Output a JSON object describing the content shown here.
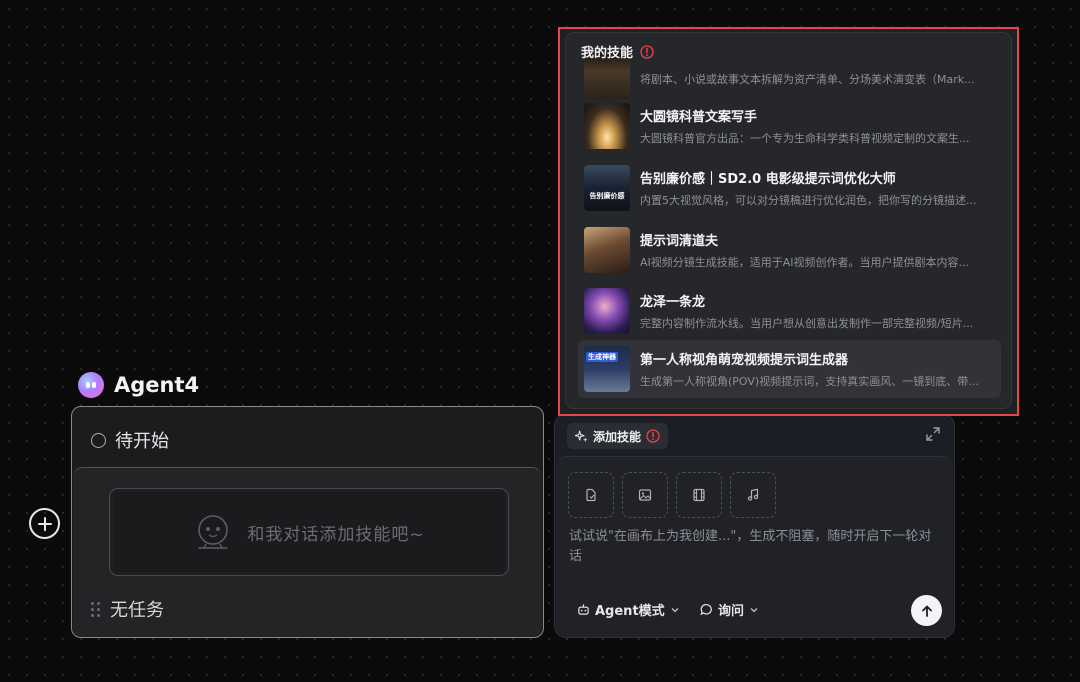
{
  "agent": {
    "name": "Agent4",
    "status": "待开始",
    "chat_hint": "和我对话添加技能吧~",
    "task_label": "无任务"
  },
  "input_panel": {
    "add_skill_label": "添加技能",
    "prompt_placeholder": "试试说\"在画布上为我创建...\"，生成不阻塞，随时开启下一轮对话",
    "mode_label": "Agent模式",
    "ask_label": "询问"
  },
  "skills_popup": {
    "title": "我的技能",
    "items": [
      {
        "name": "",
        "desc": "将剧本、小说或故事文本拆解为资产清单、分场美术演变表（Mark...",
        "thumb_caption": ""
      },
      {
        "name": "大圆镜科普文案写手",
        "desc": "大圆镜科普官方出品：一个专为生命科学类科普视频定制的文案生...",
        "thumb_caption": ""
      },
      {
        "name": "告别廉价感｜SD2.0 电影级提示词优化大师",
        "desc": "内置5大视觉风格，可以对分镜稿进行优化润色，把你写的分镜描述...",
        "thumb_caption": "告别廉价感"
      },
      {
        "name": "提示词清道夫",
        "desc": "AI视频分镜生成技能，适用于AI视频创作者。当用户提供剧本内容...",
        "thumb_caption": ""
      },
      {
        "name": "龙泽一条龙",
        "desc": "完整内容制作流水线。当用户想从创意出发制作一部完整视频/短片...",
        "thumb_caption": ""
      },
      {
        "name": "第一人称视角萌宠视频提示词生成器",
        "desc": "生成第一人称视角(POV)视频提示词，支持真实画风、一镜到底、带...",
        "thumb_caption": "生成神器"
      }
    ]
  },
  "colors": {
    "highlight_border": "#e8444b",
    "warning_icon": "#e8444b",
    "canvas_bg": "#0b0b0c"
  },
  "icons": {
    "add_node": "plus-circle-icon",
    "status": "circle-icon",
    "robot": "robot-face-icon",
    "sparkle": "sparkle-icon",
    "expand": "expand-icon",
    "upload": [
      "document-icon",
      "image-icon",
      "film-icon",
      "music-icon"
    ],
    "send": "arrow-up-icon"
  }
}
